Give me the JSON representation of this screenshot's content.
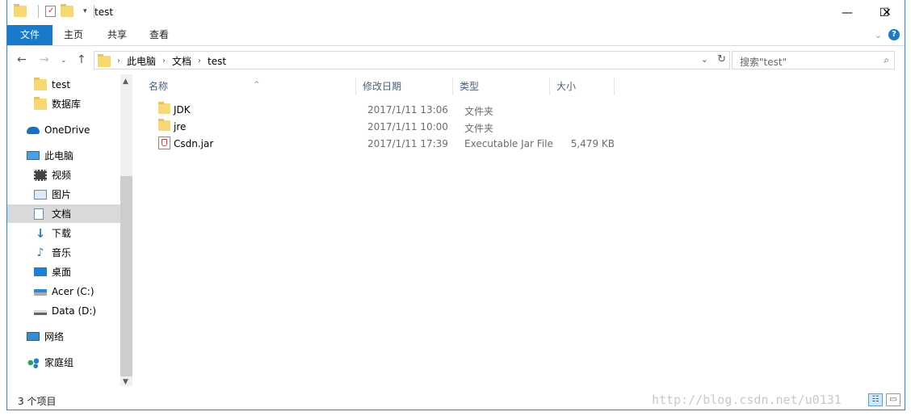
{
  "window": {
    "title": "test",
    "minimize": "—",
    "maximize": "☐",
    "close": "✕"
  },
  "ribbon": {
    "tabs": [
      "文件",
      "主页",
      "共享",
      "查看"
    ]
  },
  "address": {
    "crumbs": [
      "此电脑",
      "文档",
      "test"
    ]
  },
  "search": {
    "placeholder": "搜索\"test\""
  },
  "navpane": {
    "items": [
      {
        "label": "test",
        "icon": "folder-icon"
      },
      {
        "label": "数据库",
        "icon": "folder-icon"
      },
      {
        "label": "OneDrive",
        "icon": "cloud-icon"
      },
      {
        "label": "此电脑",
        "icon": "computer-icon"
      },
      {
        "label": "视频",
        "icon": "video-icon"
      },
      {
        "label": "图片",
        "icon": "picture-icon"
      },
      {
        "label": "文档",
        "icon": "document-icon"
      },
      {
        "label": "下载",
        "icon": "download-icon"
      },
      {
        "label": "音乐",
        "icon": "music-icon"
      },
      {
        "label": "桌面",
        "icon": "desktop-icon"
      },
      {
        "label": "Acer (C:)",
        "icon": "drive-icon"
      },
      {
        "label": "Data (D:)",
        "icon": "drive-icon"
      },
      {
        "label": "网络",
        "icon": "network-icon"
      },
      {
        "label": "家庭组",
        "icon": "homegroup-icon"
      }
    ],
    "selected": "文档"
  },
  "columns": {
    "name": "名称",
    "modified": "修改日期",
    "type": "类型",
    "size": "大小"
  },
  "files": [
    {
      "name": "JDK",
      "modified": "2017/1/11 13:06",
      "type": "文件夹",
      "size": "",
      "icon": "folder-icon"
    },
    {
      "name": "jre",
      "modified": "2017/1/11 10:00",
      "type": "文件夹",
      "size": "",
      "icon": "folder-icon"
    },
    {
      "name": "Csdn.jar",
      "modified": "2017/1/11 17:39",
      "type": "Executable Jar File",
      "size": "5,479 KB",
      "icon": "jar-file-icon"
    }
  ],
  "status": {
    "item_count": "3 个项目"
  },
  "watermark": "http://blog.csdn.net/u0131",
  "colors": {
    "accent": "#1979ca",
    "folder": "#f8d775",
    "selection": "#d9d9d9"
  }
}
